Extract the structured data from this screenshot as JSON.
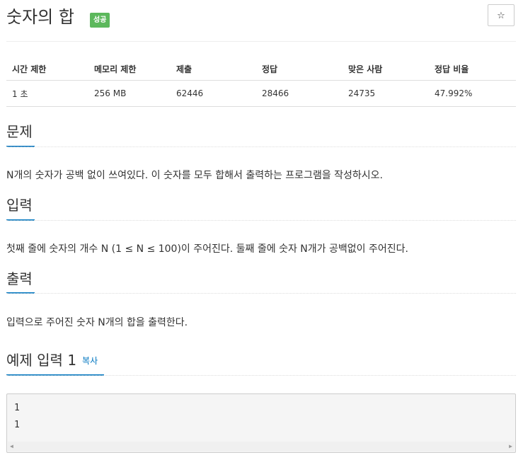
{
  "header": {
    "title": "숫자의 합",
    "badge": "성공",
    "star_icon": "☆"
  },
  "info_table": {
    "headers": [
      "시간 제한",
      "메모리 제한",
      "제출",
      "정답",
      "맞은 사람",
      "정답 비율"
    ],
    "values": [
      "1 초",
      "256 MB",
      "62446",
      "28466",
      "24735",
      "47.992%"
    ]
  },
  "sections": {
    "problem": {
      "heading": "문제",
      "text": "N개의 숫자가 공백 없이 쓰여있다. 이 숫자를 모두 합해서 출력하는 프로그램을 작성하시오."
    },
    "input": {
      "heading": "입력",
      "text": "첫째 줄에 숫자의 개수 N (1 ≤ N ≤ 100)이 주어진다. 둘째 줄에 숫자 N개가 공백없이 주어진다."
    },
    "output": {
      "heading": "출력",
      "text": "입력으로 주어진 숫자 N개의 합을 출력한다."
    },
    "sample_input": {
      "heading": "예제 입력 1",
      "copy_label": "복사",
      "lines": [
        "1",
        "1"
      ]
    }
  },
  "scroll_arrows": {
    "left": "◀",
    "right": "▶"
  }
}
